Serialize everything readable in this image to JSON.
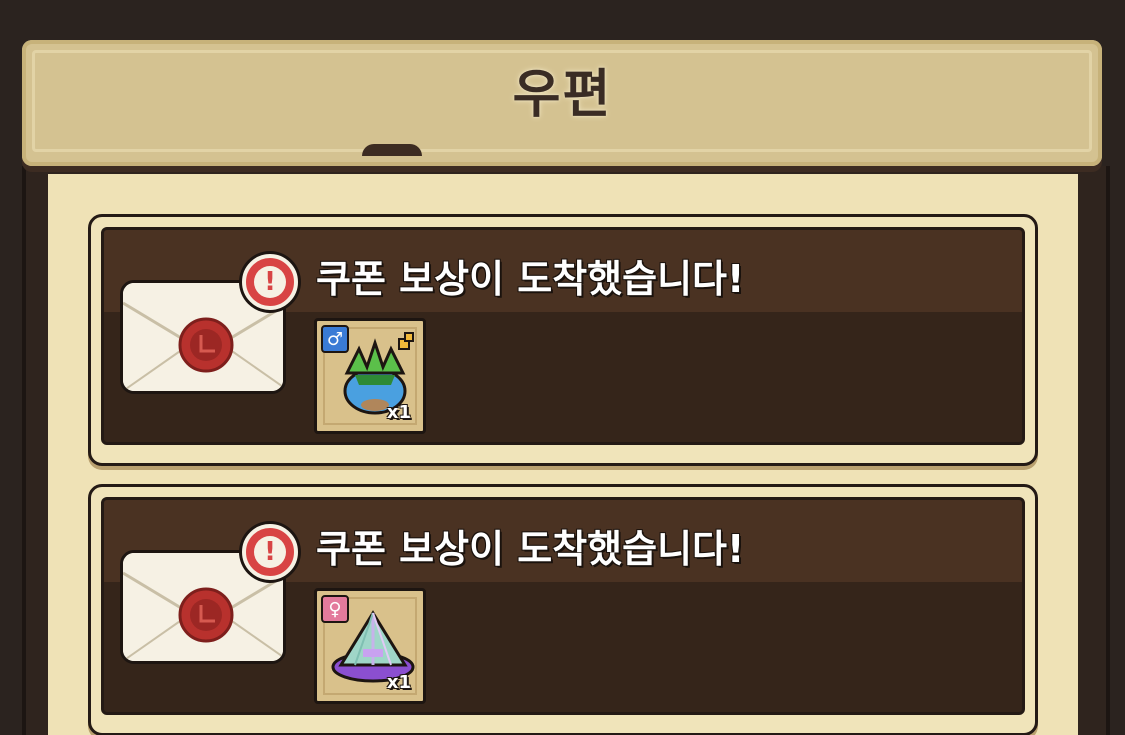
{
  "header": {
    "title": "우편"
  },
  "mails": [
    {
      "title": "쿠폰 보상이 도착했습니다!",
      "alert": "!",
      "reward": {
        "gender_symbol": "♂",
        "gender_color": "#3a7bd5",
        "quantity": "x1",
        "icon": "plant-headgear-icon"
      }
    },
    {
      "title": "쿠폰 보상이 도착했습니다!",
      "alert": "!",
      "reward": {
        "gender_symbol": "♀",
        "gender_color": "#e37a9c",
        "quantity": "x1",
        "icon": "crystal-pyramid-icon"
      }
    }
  ],
  "colors": {
    "panel_bg": "#efe2b6",
    "card_dark": "#35251a",
    "banner": "#d4c291",
    "alert_red": "#d84444"
  }
}
